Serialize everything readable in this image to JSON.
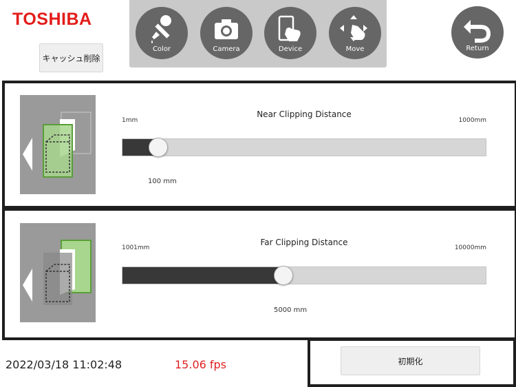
{
  "header": {
    "brand": "TOSHIBA",
    "clear_cache_label": "キャッシュ削除",
    "tools": [
      {
        "label": "Color",
        "icon": "dropper-icon"
      },
      {
        "label": "Camera",
        "icon": "camera-icon"
      },
      {
        "label": "Device",
        "icon": "tablet-touch-icon"
      },
      {
        "label": "Move",
        "icon": "move-hand-icon"
      }
    ],
    "return_label": "Return"
  },
  "near": {
    "title": "Near Clipping Distance",
    "min_label": "1mm",
    "max_label": "1000mm",
    "value_label": "100 mm",
    "position": 0.099
  },
  "far": {
    "title": "Far Clipping Distance",
    "min_label": "1001mm",
    "max_label": "10000mm",
    "value_label": "5000 mm",
    "position": 0.444
  },
  "status": {
    "datetime": "2022/03/18 11:02:48",
    "fps": "15.06 fps"
  },
  "reset_label": "初期化",
  "colors": {
    "brand": "#e31d1a",
    "fps": "#e02020",
    "tool_bg": "#666666",
    "track_fill": "#383838",
    "track_bg": "#d6d6d6"
  }
}
